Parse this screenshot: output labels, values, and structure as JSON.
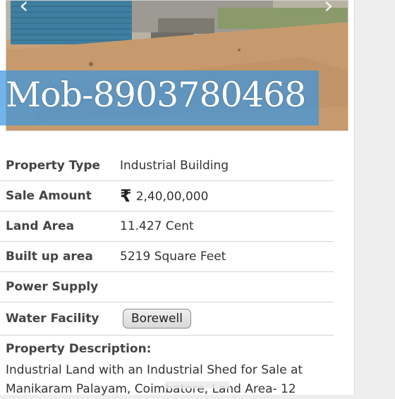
{
  "gallery": {
    "overlay_text": "Mob-8903780468",
    "prev_icon": "chevron-left-icon",
    "next_icon": "chevron-right-icon"
  },
  "details": [
    {
      "label": "Property Type",
      "value": "Industrial Building"
    },
    {
      "label": "Sale Amount",
      "currency_symbol": "₹",
      "value": "2,40,00,000"
    },
    {
      "label": "Land Area",
      "value": "11.427 Cent"
    },
    {
      "label": "Built up area",
      "value": "5219 Square Feet"
    },
    {
      "label": "Power Supply",
      "value": ""
    },
    {
      "label": "Water Facility",
      "badge": "Borewell"
    }
  ],
  "description": {
    "heading": "Property Description:",
    "text": "Industrial Land with an Industrial Shed for Sale at Manikaram Palayam, Coimbatore, Land Area- 12"
  }
}
